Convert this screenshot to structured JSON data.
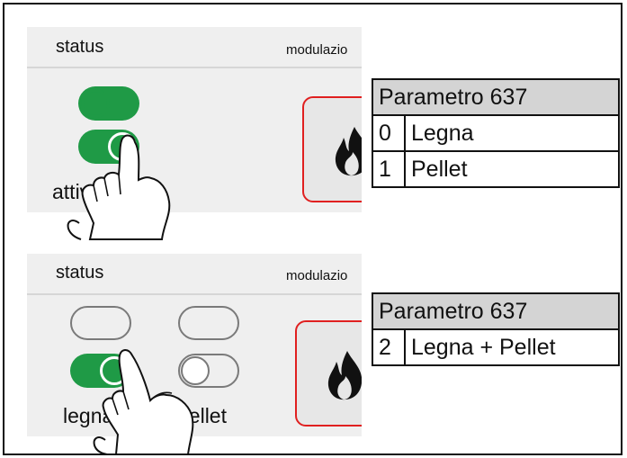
{
  "top_panel": {
    "status_label": "status",
    "modulation_label": "modulazio",
    "caption": "attiva   one",
    "toggles": [
      {
        "name": "toggle-upper",
        "state": "on"
      },
      {
        "name": "toggle-attivazione",
        "state": "on"
      }
    ],
    "flame_icon": "flame-icon"
  },
  "bottom_panel": {
    "status_label": "status",
    "modulation_label": "modulazio",
    "legna_label": "legna",
    "pellet_label": "pellet",
    "toggles": [
      {
        "name": "toggle-left-upper",
        "state": "off"
      },
      {
        "name": "toggle-right-upper",
        "state": "off"
      },
      {
        "name": "toggle-legna",
        "state": "on"
      },
      {
        "name": "toggle-pellet",
        "state": "off"
      }
    ],
    "flame_icon": "flame-icon"
  },
  "table_top": {
    "header": "Parametro 637",
    "rows": [
      {
        "index": "0",
        "label": "Legna"
      },
      {
        "index": "1",
        "label": "Pellet"
      }
    ]
  },
  "table_bottom": {
    "header": "Parametro 637",
    "rows": [
      {
        "index": "2",
        "label": "Legna + Pellet"
      }
    ]
  },
  "colors": {
    "toggle_on": "#1f9a46",
    "button_border": "#e02020",
    "panel_bg": "#efefef",
    "table_header_bg": "#d4d4d4"
  }
}
